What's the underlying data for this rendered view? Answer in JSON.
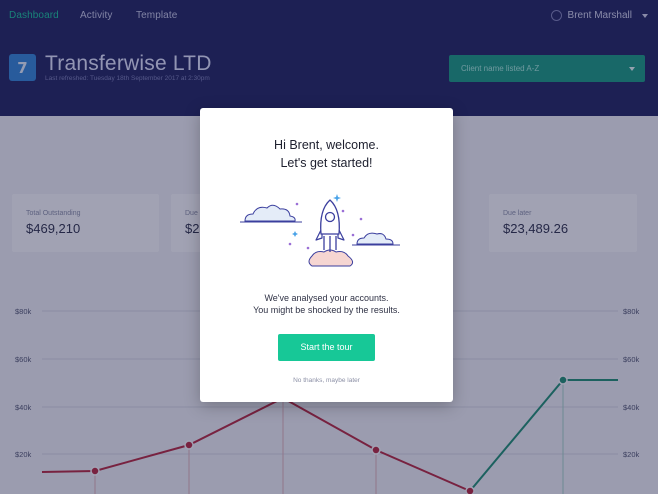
{
  "nav": {
    "items": [
      {
        "label": "Dashboard",
        "active": true
      },
      {
        "label": "Activity",
        "active": false
      },
      {
        "label": "Template",
        "active": false
      }
    ],
    "user_name": "Brent Marshall"
  },
  "company": {
    "name": "Transferwise LTD",
    "last_refreshed": "Last refreshed: Tuesday 18th September 2017 at 2:30pm",
    "logo_glyph": "7"
  },
  "client_select": {
    "selected": "Client name listed A-Z"
  },
  "cards": [
    {
      "label": "Total Outstanding",
      "value": "$469,210"
    },
    {
      "label": "Due",
      "value": "$2"
    },
    {
      "label": "Due later",
      "value": "$23,489.26"
    }
  ],
  "chart": {
    "y_ticks": [
      "$80k",
      "$60k",
      "$40k",
      "$20k"
    ]
  },
  "modal": {
    "title_line1": "Hi Brent, welcome.",
    "title_line2": "Let's get started!",
    "body_line1": "We've analysed your accounts.",
    "body_line2": "You might be shocked by the results.",
    "cta": "Start the tour",
    "skip": "No thanks, maybe later"
  },
  "colors": {
    "header_bg": "#1c1f5c",
    "accent": "#17c897",
    "select_bg": "#149c7f",
    "line_red": "#b8243a",
    "line_green": "#1a8f6f"
  }
}
